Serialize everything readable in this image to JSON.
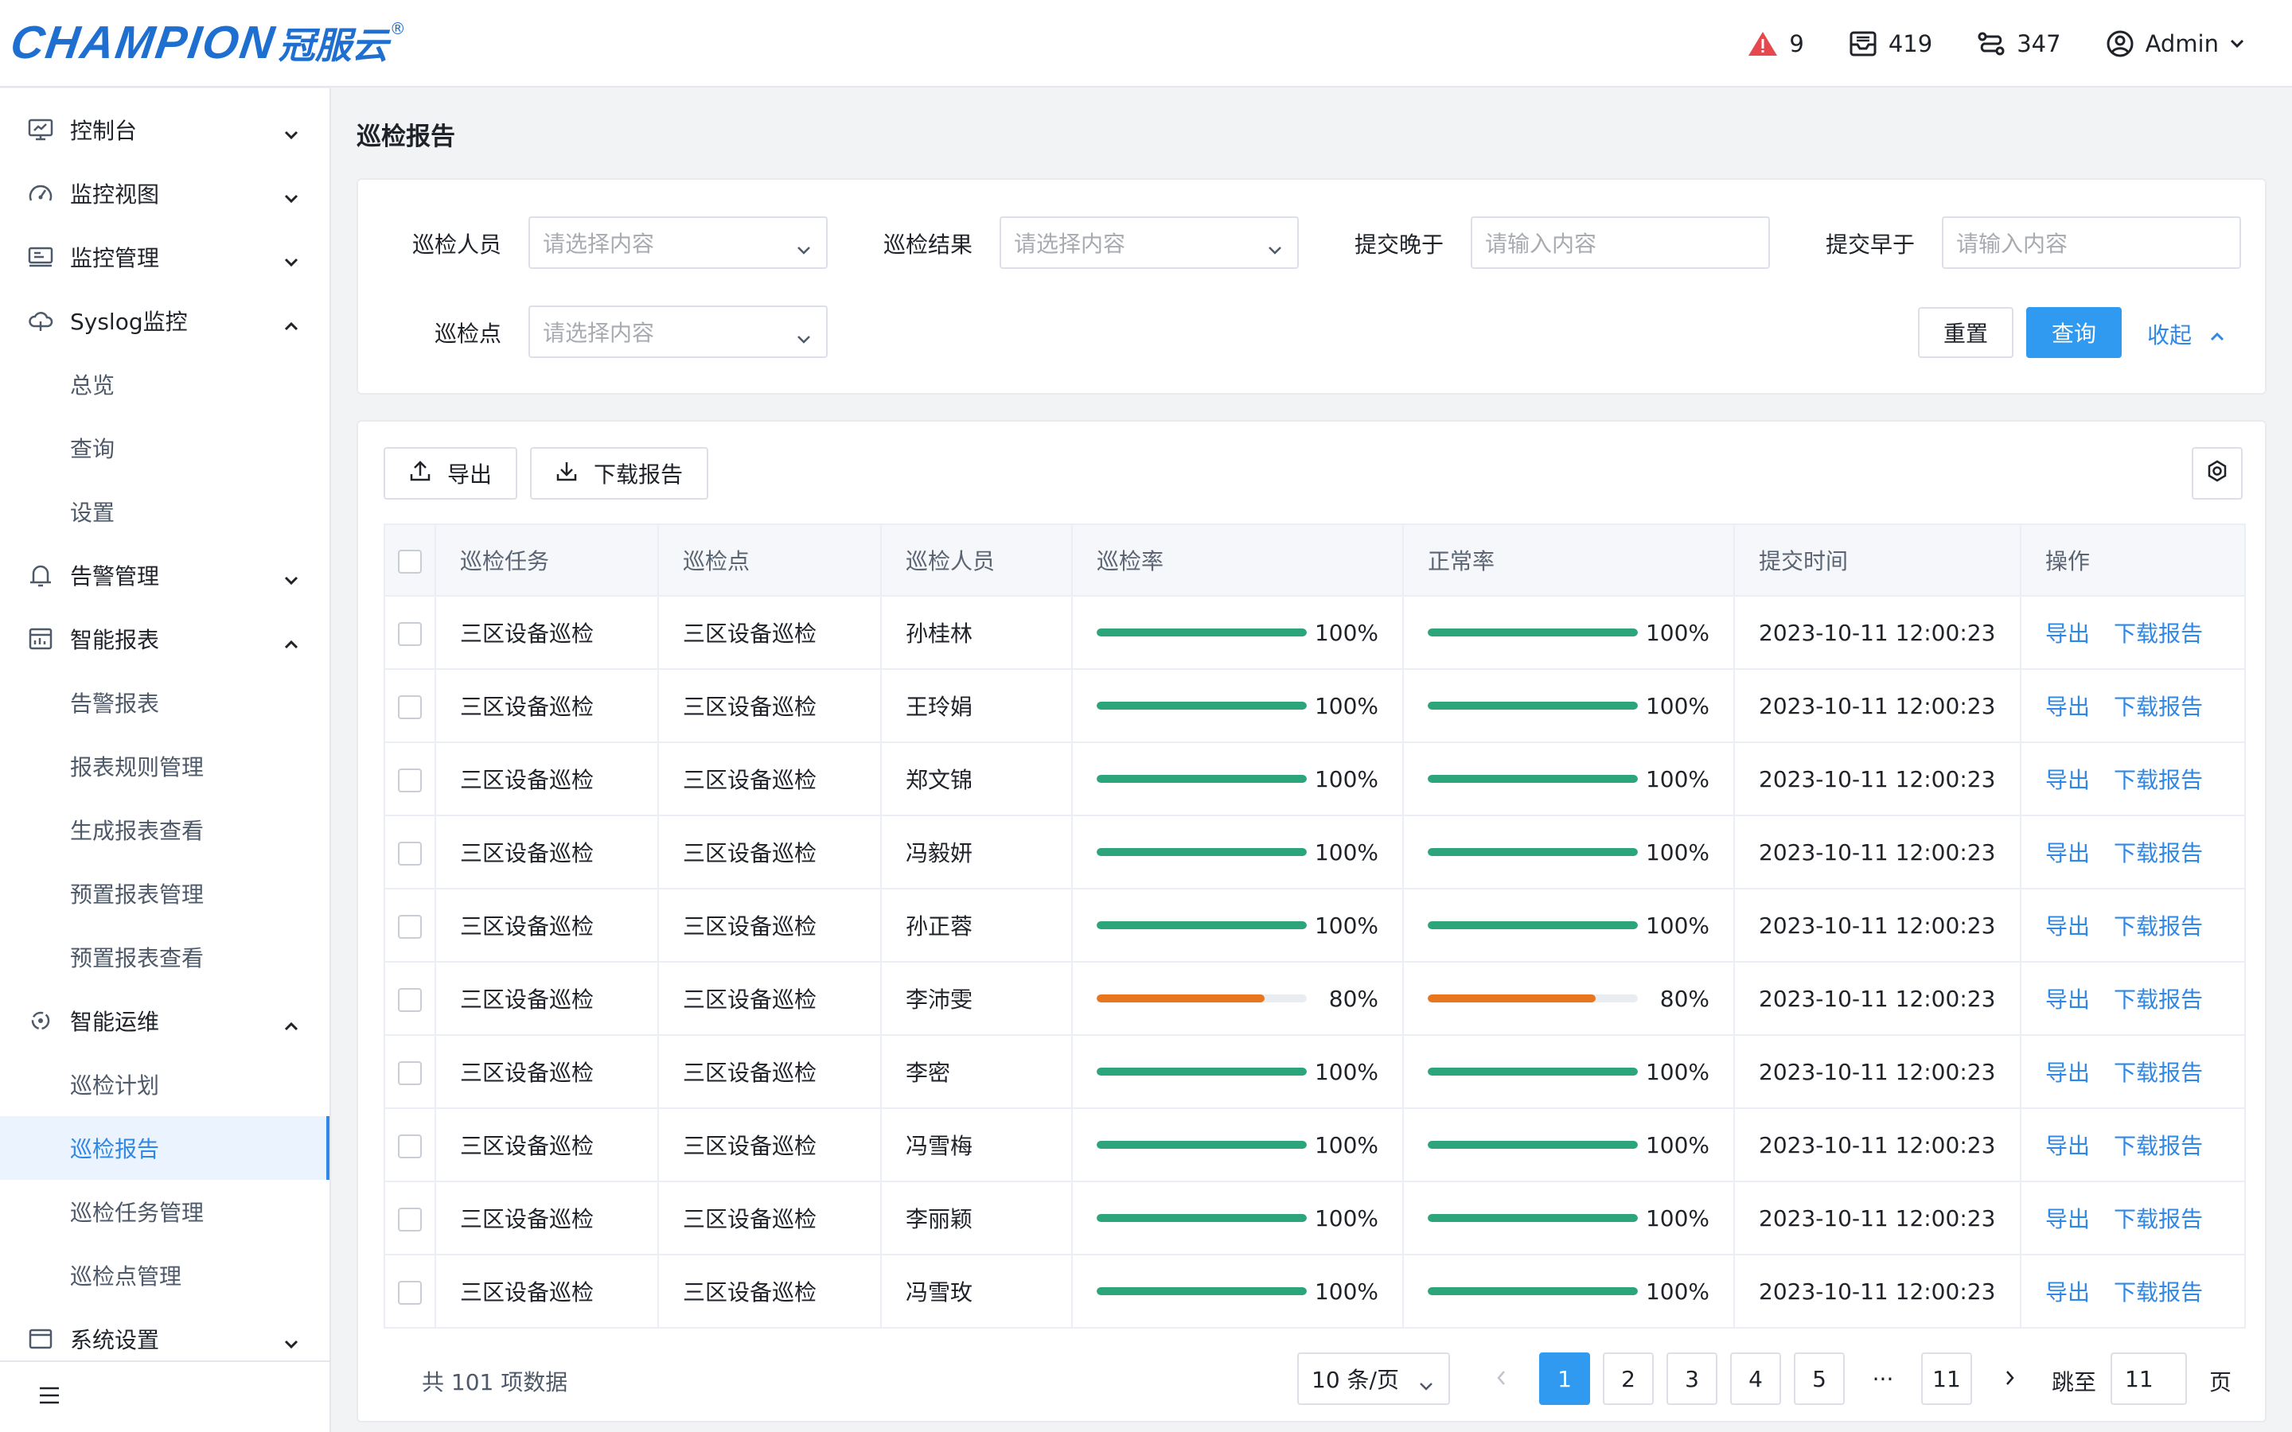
{
  "brand": {
    "logo_en": "CHAMPION",
    "logo_cn": "冠服云",
    "logo_mark": "®"
  },
  "header": {
    "alerts": "9",
    "devices": "419",
    "links": "347",
    "user": "Admin"
  },
  "sidebar": {
    "items": [
      {
        "label": "控制台",
        "icon": "monitor-icon",
        "expanded": false
      },
      {
        "label": "监控视图",
        "icon": "dashboard-icon",
        "expanded": false
      },
      {
        "label": "监控管理",
        "icon": "monitor-settings-icon",
        "expanded": false
      },
      {
        "label": "Syslog监控",
        "icon": "cloud-icon",
        "expanded": true,
        "children": [
          "总览",
          "查询",
          "设置"
        ]
      },
      {
        "label": "告警管理",
        "icon": "bell-icon",
        "expanded": false
      },
      {
        "label": "智能报表",
        "icon": "report-icon",
        "expanded": true,
        "children": [
          "告警报表",
          "报表规则管理",
          "生成报表查看",
          "预置报表管理",
          "预置报表查看"
        ]
      },
      {
        "label": "智能运维",
        "icon": "ops-icon",
        "expanded": true,
        "children": [
          "巡检计划",
          "巡检报告",
          "巡检任务管理",
          "巡检点管理"
        ]
      },
      {
        "label": "系统设置",
        "icon": "settings-icon",
        "expanded": false
      }
    ],
    "active": "巡检报告"
  },
  "page": {
    "title": "巡检报告"
  },
  "filters": {
    "inspector_label": "巡检人员",
    "inspector_placeholder": "请选择内容",
    "result_label": "巡检结果",
    "result_placeholder": "请选择内容",
    "after_label": "提交晚于",
    "after_placeholder": "请输入内容",
    "before_label": "提交早于",
    "before_placeholder": "请输入内容",
    "point_label": "巡检点",
    "point_placeholder": "请选择内容",
    "reset": "重置",
    "query": "查询",
    "collapse": "收起"
  },
  "toolbar": {
    "export": "导出",
    "download": "下载报告"
  },
  "table": {
    "columns": [
      "巡检任务",
      "巡检点",
      "巡检人员",
      "巡检率",
      "正常率",
      "提交时间",
      "操作"
    ],
    "op_export": "导出",
    "op_download": "下载报告",
    "rows": [
      {
        "task": "三区设备巡检",
        "point": "三区设备巡检",
        "person": "孙桂林",
        "inspect_rate": "100%",
        "inspect_val": 100,
        "normal_rate": "100%",
        "normal_val": 100,
        "time": "2023-10-11 12:00:23"
      },
      {
        "task": "三区设备巡检",
        "point": "三区设备巡检",
        "person": "王玲娟",
        "inspect_rate": "100%",
        "inspect_val": 100,
        "normal_rate": "100%",
        "normal_val": 100,
        "time": "2023-10-11 12:00:23"
      },
      {
        "task": "三区设备巡检",
        "point": "三区设备巡检",
        "person": "郑文锦",
        "inspect_rate": "100%",
        "inspect_val": 100,
        "normal_rate": "100%",
        "normal_val": 100,
        "time": "2023-10-11 12:00:23"
      },
      {
        "task": "三区设备巡检",
        "point": "三区设备巡检",
        "person": "冯毅妍",
        "inspect_rate": "100%",
        "inspect_val": 100,
        "normal_rate": "100%",
        "normal_val": 100,
        "time": "2023-10-11 12:00:23"
      },
      {
        "task": "三区设备巡检",
        "point": "三区设备巡检",
        "person": "孙正蓉",
        "inspect_rate": "100%",
        "inspect_val": 100,
        "normal_rate": "100%",
        "normal_val": 100,
        "time": "2023-10-11 12:00:23"
      },
      {
        "task": "三区设备巡检",
        "point": "三区设备巡检",
        "person": "李沛雯",
        "inspect_rate": "80%",
        "inspect_val": 80,
        "normal_rate": "80%",
        "normal_val": 80,
        "time": "2023-10-11 12:00:23"
      },
      {
        "task": "三区设备巡检",
        "point": "三区设备巡检",
        "person": "李密",
        "inspect_rate": "100%",
        "inspect_val": 100,
        "normal_rate": "100%",
        "normal_val": 100,
        "time": "2023-10-11 12:00:23"
      },
      {
        "task": "三区设备巡检",
        "point": "三区设备巡检",
        "person": "冯雪梅",
        "inspect_rate": "100%",
        "inspect_val": 100,
        "normal_rate": "100%",
        "normal_val": 100,
        "time": "2023-10-11 12:00:23"
      },
      {
        "task": "三区设备巡检",
        "point": "三区设备巡检",
        "person": "李丽颖",
        "inspect_rate": "100%",
        "inspect_val": 100,
        "normal_rate": "100%",
        "normal_val": 100,
        "time": "2023-10-11 12:00:23"
      },
      {
        "task": "三区设备巡检",
        "point": "三区设备巡检",
        "person": "冯雪玫",
        "inspect_rate": "100%",
        "inspect_val": 100,
        "normal_rate": "100%",
        "normal_val": 100,
        "time": "2023-10-11 12:00:23"
      }
    ]
  },
  "pagination": {
    "total_text": "共 101 项数据",
    "page_size": "10 条/页",
    "pages": [
      "1",
      "2",
      "3",
      "4",
      "5"
    ],
    "ellipsis": "···",
    "last_page": "11",
    "current": "1",
    "jump_label": "跳至",
    "jump_value": "11",
    "jump_unit": "页"
  },
  "colors": {
    "accent": "#2f9af0",
    "link": "#2f88e6",
    "ok": "#2ca57a",
    "warn": "#e8761f",
    "alert": "#e5484d"
  }
}
